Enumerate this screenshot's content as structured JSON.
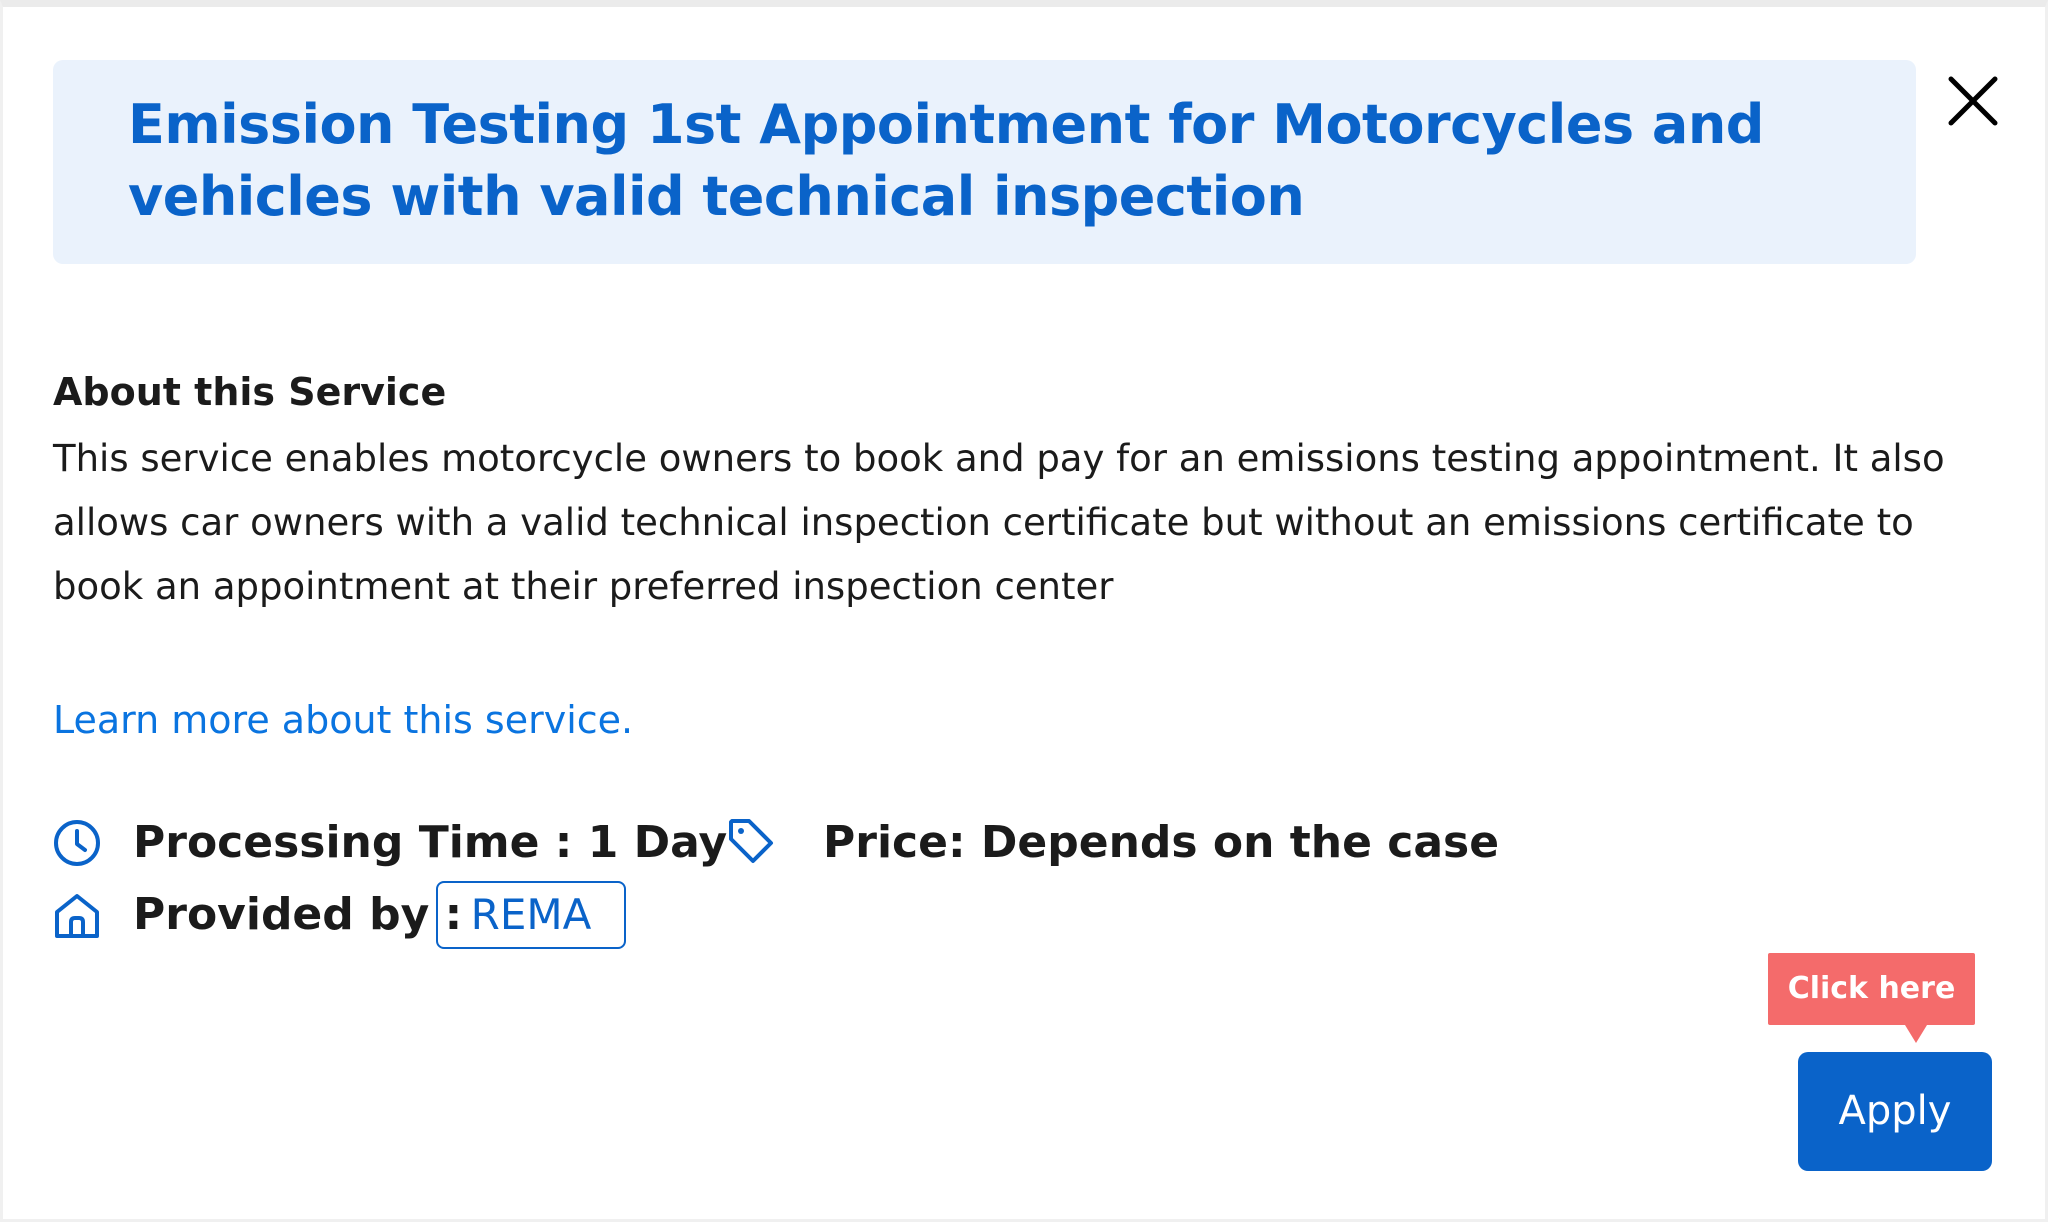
{
  "dialog": {
    "title": "Emission Testing 1st Appointment for Motorcycles and vehicles with valid technical inspection",
    "close_icon": "close-icon"
  },
  "about": {
    "heading": "About this Service",
    "body": "This service enables motorcycle owners to book and pay for an emissions testing appointment. It also allows car owners with a valid technical inspection certificate but without an emissions certificate to book an appointment at their preferred inspection center"
  },
  "learn_more": {
    "label": "Learn more about this service."
  },
  "meta": {
    "processing_time": "Processing Time : 1 Day",
    "processing_icon": "clock-icon",
    "price": "Price: Depends on the case",
    "price_icon": "price-tag-icon",
    "provided_by_label": "Provided by :",
    "provided_by_icon": "home-icon",
    "provider": "REMA"
  },
  "tooltip": {
    "label": "Click here"
  },
  "actions": {
    "apply_label": "Apply"
  },
  "colors": {
    "accent": "#0a63c9",
    "title_background": "#eaf2fc",
    "link": "#0a74e0",
    "tooltip": "#f46b6b",
    "text": "#1b1b1b"
  }
}
